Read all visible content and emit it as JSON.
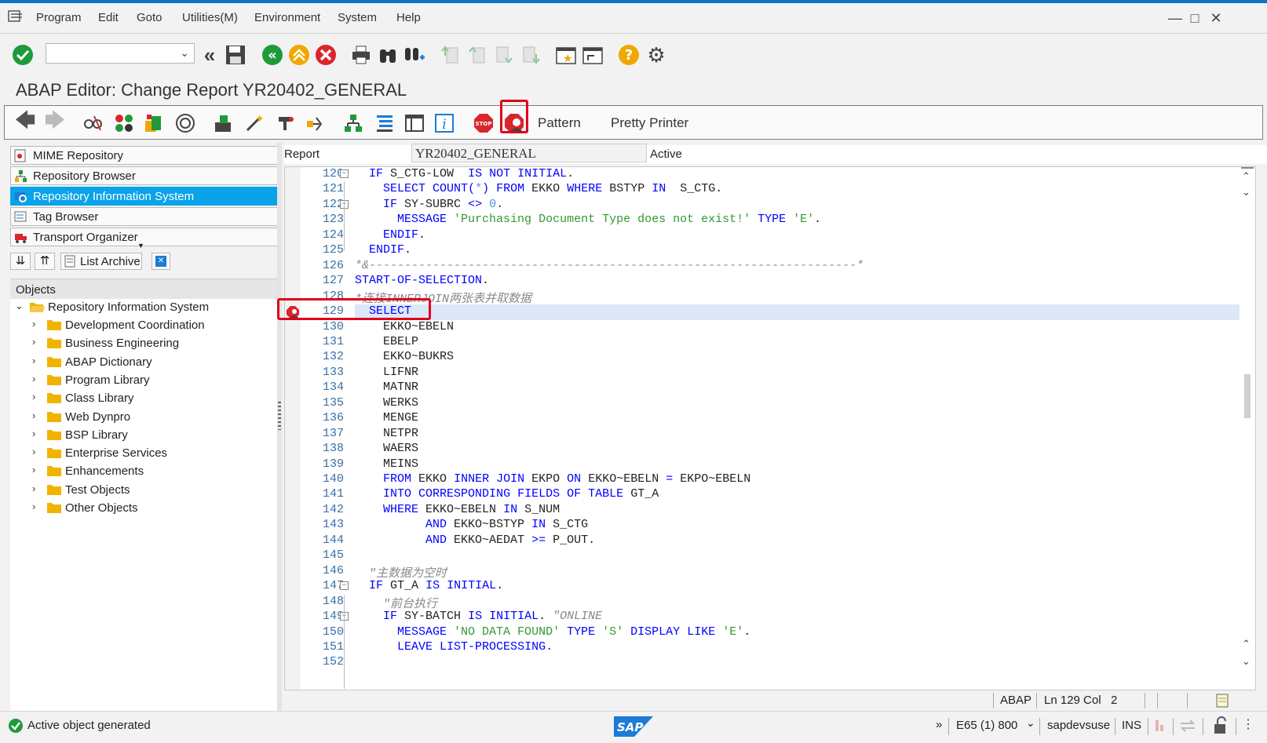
{
  "menu": {
    "items": [
      "Program",
      "Edit",
      "Goto",
      "Utilities(M)",
      "Environment",
      "System",
      "Help"
    ]
  },
  "window": {
    "title": "ABAP Editor: Change Report YR20402_GENERAL"
  },
  "toolbar2": {
    "pattern_label": "Pattern",
    "pretty_printer_label": "Pretty Printer"
  },
  "nav": {
    "items": [
      {
        "label": "MIME Repository"
      },
      {
        "label": "Repository Browser"
      },
      {
        "label": "Repository Information System"
      },
      {
        "label": "Tag Browser"
      },
      {
        "label": "Transport Organizer"
      }
    ],
    "list_archive_label": "List Archive"
  },
  "objects": {
    "header": "Objects",
    "root": "Repository Information System",
    "children": [
      "Development Coordination",
      "Business Engineering",
      "ABAP Dictionary",
      "Program Library",
      "Class Library",
      "Web Dynpro",
      "BSP Library",
      "Enterprise Services",
      "Enhancements",
      "Test Objects",
      "Other Objects"
    ]
  },
  "report": {
    "label": "Report",
    "name": "YR20402_GENERAL",
    "status": "Active"
  },
  "code": {
    "lines": [
      {
        "n": "120",
        "t": "  IF S_CTG-LOW  IS NOT INITIAL."
      },
      {
        "n": "121",
        "t": "    SELECT COUNT(*) FROM EKKO WHERE BSTYP IN  S_CTG."
      },
      {
        "n": "122",
        "t": "    IF SY-SUBRC <> 0."
      },
      {
        "n": "123",
        "t": "      MESSAGE 'Purchasing Document Type does not exist!' TYPE 'E'."
      },
      {
        "n": "124",
        "t": "    ENDIF."
      },
      {
        "n": "125",
        "t": "  ENDIF."
      },
      {
        "n": "126",
        "t": "*&---------------------------------------------------------------------*"
      },
      {
        "n": "127",
        "t": "START-OF-SELECTION."
      },
      {
        "n": "128",
        "t": "*连接INNERJOIN两张表并取数据"
      },
      {
        "n": "129",
        "t": "  SELECT"
      },
      {
        "n": "130",
        "t": "    EKKO~EBELN"
      },
      {
        "n": "131",
        "t": "    EBELP"
      },
      {
        "n": "132",
        "t": "    EKKO~BUKRS"
      },
      {
        "n": "133",
        "t": "    LIFNR"
      },
      {
        "n": "134",
        "t": "    MATNR"
      },
      {
        "n": "135",
        "t": "    WERKS"
      },
      {
        "n": "136",
        "t": "    MENGE"
      },
      {
        "n": "137",
        "t": "    NETPR"
      },
      {
        "n": "138",
        "t": "    WAERS"
      },
      {
        "n": "139",
        "t": "    MEINS"
      },
      {
        "n": "140",
        "t": "    FROM EKKO INNER JOIN EKPO ON EKKO~EBELN = EKPO~EBELN"
      },
      {
        "n": "141",
        "t": "    INTO CORRESPONDING FIELDS OF TABLE GT_A"
      },
      {
        "n": "142",
        "t": "    WHERE EKKO~EBELN IN S_NUM"
      },
      {
        "n": "143",
        "t": "          AND EKKO~BSTYP IN S_CTG"
      },
      {
        "n": "144",
        "t": "          AND EKKO~AEDAT >= P_OUT."
      },
      {
        "n": "145",
        "t": ""
      },
      {
        "n": "146",
        "t": "  \"主数据为空时"
      },
      {
        "n": "147",
        "t": "  IF GT_A IS INITIAL."
      },
      {
        "n": "148",
        "t": "    \"前台执行"
      },
      {
        "n": "149",
        "t": "    IF SY-BATCH IS INITIAL. \"ONLINE"
      },
      {
        "n": "150",
        "t": "      MESSAGE 'NO DATA FOUND' TYPE 'S' DISPLAY LIKE 'E'."
      },
      {
        "n": "151",
        "t": "      LEAVE LIST-PROCESSING."
      },
      {
        "n": "152",
        "t": ""
      }
    ]
  },
  "editor_status": {
    "lang": "ABAP",
    "position": "Ln 129 Col   2"
  },
  "status": {
    "message": "Active object generated",
    "system": "E65 (1) 800",
    "server": "sapdevsuse",
    "mode": "INS"
  },
  "colors": {
    "accent": "#0aa3ea",
    "keyword": "#0000ff",
    "string": "#339933",
    "highlight_box": "#e0001b"
  }
}
